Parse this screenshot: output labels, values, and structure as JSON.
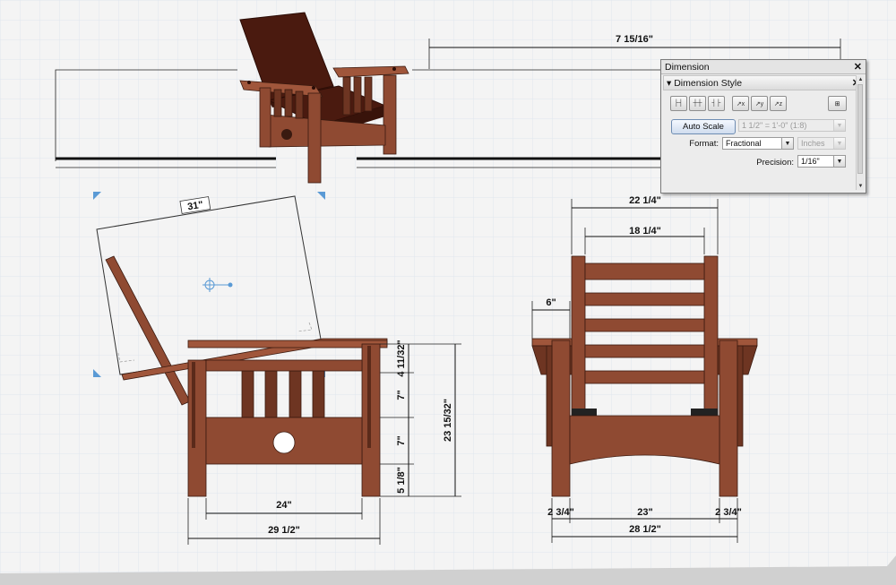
{
  "drawing": {
    "dims": {
      "top_overall": "7 15/16\"",
      "back_width": "31\"",
      "overall_width": "22 1/4\"",
      "inner_width": "18 1/4\"",
      "arm_overhang": "6\"",
      "side_seg_1": "4 11/32\"",
      "side_seg_2": "7\"",
      "side_seg_3": "7\"",
      "side_seg_4": "5 1/8\"",
      "side_height": "23 15/32\"",
      "side_inner_depth": "24\"",
      "side_overall_depth": "29 1/2\"",
      "front_leg_left": "2 3/4\"",
      "front_inner": "23\"",
      "front_leg_right": "2 3/4\"",
      "front_overall": "28 1/2\""
    }
  },
  "palette": {
    "window_title": "Dimension",
    "section_title": "Dimension Style",
    "tool_buttons": [
      "tick-base",
      "tick-mid",
      "tick-end",
      "arrow-x",
      "arrow-y",
      "arrow-z"
    ],
    "auto_scale_label": "Auto Scale",
    "scale_value": "1 1/2\" = 1'-0\" (1:8)",
    "format_label": "Format:",
    "format_value": "Fractional",
    "units_value": "Inches",
    "precision_label": "Precision:",
    "precision_value": "1/16\""
  },
  "colors": {
    "grid": "#dfe6ee",
    "wood": "#8f4a32",
    "wood_dark": "#6e3522",
    "handle": "#5a9ad5"
  }
}
